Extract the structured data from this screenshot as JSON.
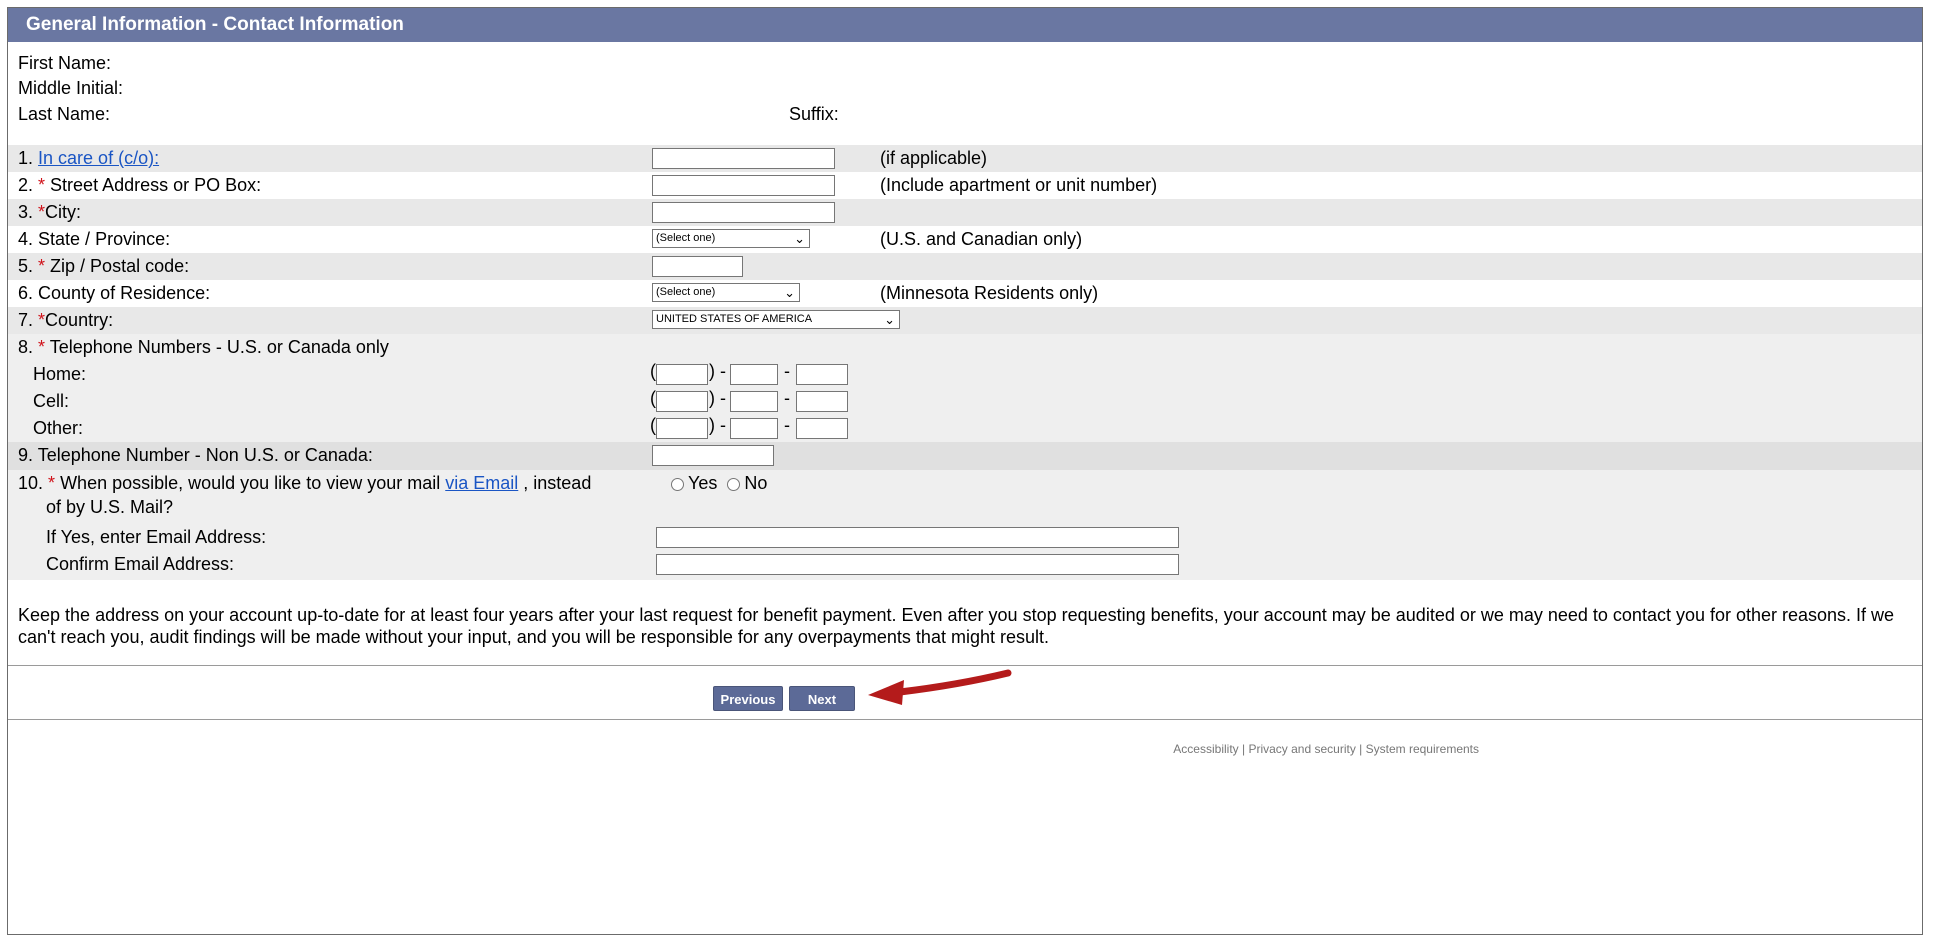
{
  "header": {
    "title": "General Information - Contact Information"
  },
  "identity": {
    "first_name": "First Name:",
    "middle_initial": "Middle Initial:",
    "last_name": "Last Name:",
    "suffix": "Suffix:"
  },
  "fields": {
    "care_of": {
      "num": "1.",
      "label": "In care of (c/o):",
      "hint": "(if applicable)"
    },
    "street": {
      "num": "2.",
      "req": "*",
      "label": " Street Address or PO Box:",
      "hint": "(Include apartment or unit number)"
    },
    "city": {
      "num": "3.",
      "req": "*",
      "label": "City:"
    },
    "state": {
      "num": "4.",
      "label": "State / Province:",
      "select": "(Select one)",
      "hint": "(U.S. and Canadian only)"
    },
    "zip": {
      "num": "5.",
      "req": "*",
      "label": " Zip / Postal code:"
    },
    "county": {
      "num": "6.",
      "label": "County of Residence:",
      "select": "(Select one)",
      "hint": "(Minnesota Residents only)"
    },
    "country": {
      "num": "7.",
      "req": "*",
      "label": "Country:",
      "select": "UNITED STATES OF AMERICA"
    },
    "phones": {
      "num": "8.",
      "req": "*",
      "label": " Telephone Numbers - U.S. or Canada only",
      "home": "Home:",
      "cell": "Cell:",
      "other": "Other:"
    },
    "intl_phone": {
      "num": "9.",
      "label": "Telephone Number - Non U.S. or Canada:"
    },
    "email_pref": {
      "num": "10.",
      "req": "*",
      "label_pre": " When possible, would you like to view your mail ",
      "link": "via Email",
      "label_post": " , instead",
      "label_line2": "of by U.S. Mail?",
      "yes": "Yes",
      "no": "No",
      "email_label": "If Yes, enter Email Address:",
      "confirm_label": "Confirm Email Address:"
    }
  },
  "notice": "Keep the address on your account up-to-date for at least four years after your last request for benefit payment.  Even after you stop requesting benefits, your account may be audited or we may need to contact you for other reasons.  If we can't reach you, audit findings will be made without your input, and you will be responsible for any overpayments that might result.",
  "buttons": {
    "previous": "Previous",
    "next": "Next"
  },
  "footer": {
    "accessibility": "Accessibility",
    "privacy": "Privacy and security",
    "requirements": "System requirements",
    "sep": " | "
  },
  "colors": {
    "header_bg": "#6a77a2",
    "required": "#d0121a",
    "link": "#1a55c4",
    "row_shade": "#e8e8e8"
  }
}
